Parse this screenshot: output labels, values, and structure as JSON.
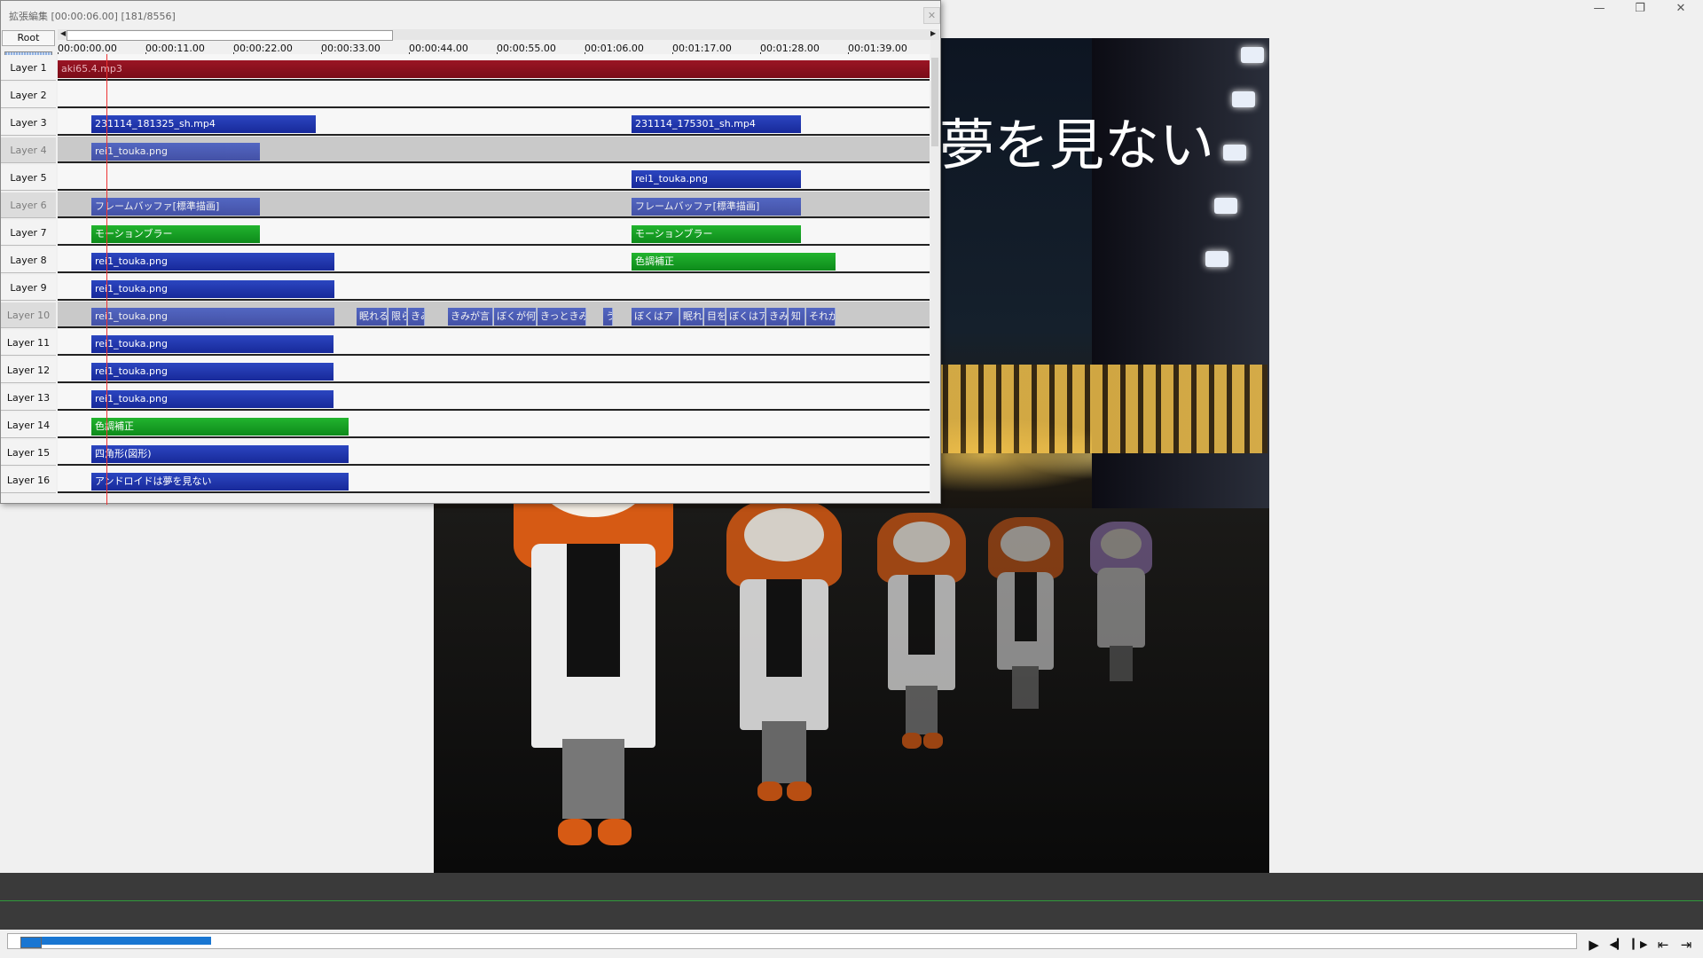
{
  "window": {
    "minimize": "—",
    "maximize": "❐",
    "close": "✕"
  },
  "timeline": {
    "title": "拡張編集 [00:00:06.00] [181/8556]",
    "close_label": "✕",
    "root_label": "Root",
    "ruler_labels": [
      "00:00:00.00",
      "00:00:11.00",
      "00:00:22.00",
      "00:00:33.00",
      "00:00:44.00",
      "00:00:55.00",
      "00:01:06.00",
      "00:01:17.00",
      "00:01:28.00",
      "00:01:39.00"
    ],
    "layers": [
      {
        "label": "Layer 1",
        "enabled": true,
        "clips": [
          {
            "name": "aki65.4.mp3",
            "kind": "audio"
          }
        ]
      },
      {
        "label": "Layer 2",
        "enabled": true,
        "clips": []
      },
      {
        "label": "Layer 3",
        "enabled": true,
        "clips": [
          {
            "name": "231114_181325_sh.mp4",
            "kind": "media"
          },
          {
            "name": "231114_175301_sh.mp4",
            "kind": "media"
          }
        ]
      },
      {
        "label": "Layer 4",
        "enabled": false,
        "clips": [
          {
            "name": "rei1_touka.png",
            "kind": "media"
          }
        ]
      },
      {
        "label": "Layer 5",
        "enabled": true,
        "clips": [
          {
            "name": "rei1_touka.png",
            "kind": "media"
          }
        ]
      },
      {
        "label": "Layer 6",
        "enabled": false,
        "clips": [
          {
            "name": "フレームバッファ[標準描画]",
            "kind": "media"
          },
          {
            "name": "フレームバッファ[標準描画]",
            "kind": "media"
          }
        ]
      },
      {
        "label": "Layer 7",
        "enabled": true,
        "clips": [
          {
            "name": "モーションブラー",
            "kind": "filter"
          },
          {
            "name": "モーションブラー",
            "kind": "filter"
          }
        ]
      },
      {
        "label": "Layer 8",
        "enabled": true,
        "clips": [
          {
            "name": "rei1_touka.png",
            "kind": "media"
          },
          {
            "name": "色調補正",
            "kind": "filter"
          }
        ]
      },
      {
        "label": "Layer 9",
        "enabled": true,
        "clips": [
          {
            "name": "rei1_touka.png",
            "kind": "media"
          }
        ]
      },
      {
        "label": "Layer 10",
        "enabled": false,
        "clips": [
          {
            "name": "rei1_touka.png",
            "kind": "media"
          },
          {
            "name": "眠れると",
            "kind": "media"
          },
          {
            "name": "限ら",
            "kind": "media"
          },
          {
            "name": "きみ",
            "kind": "media"
          },
          {
            "name": "きみが言",
            "kind": "media"
          },
          {
            "name": "ぼくが何",
            "kind": "media"
          },
          {
            "name": "きっときみ",
            "kind": "media"
          },
          {
            "name": "う",
            "kind": "media"
          },
          {
            "name": "ぼくはア",
            "kind": "media"
          },
          {
            "name": "眠れ",
            "kind": "media"
          },
          {
            "name": "目を",
            "kind": "media"
          },
          {
            "name": "ぼくはア",
            "kind": "media"
          },
          {
            "name": "きみ",
            "kind": "media"
          },
          {
            "name": "知",
            "kind": "media"
          },
          {
            "name": "それが",
            "kind": "media"
          }
        ]
      },
      {
        "label": "Layer 11",
        "enabled": true,
        "clips": [
          {
            "name": "rei1_touka.png",
            "kind": "media"
          }
        ]
      },
      {
        "label": "Layer 12",
        "enabled": true,
        "clips": [
          {
            "name": "rei1_touka.png",
            "kind": "media"
          }
        ]
      },
      {
        "label": "Layer 13",
        "enabled": true,
        "clips": [
          {
            "name": "rei1_touka.png",
            "kind": "media"
          }
        ]
      },
      {
        "label": "Layer 14",
        "enabled": true,
        "clips": [
          {
            "name": "色調補正",
            "kind": "filter"
          }
        ]
      },
      {
        "label": "Layer 15",
        "enabled": true,
        "clips": [
          {
            "name": "四角形(図形)",
            "kind": "media"
          }
        ]
      },
      {
        "label": "Layer 16",
        "enabled": true,
        "clips": [
          {
            "name": "アンドロイドは夢を見ない",
            "kind": "media"
          }
        ]
      }
    ]
  },
  "preview": {
    "caption": "夢を見ない"
  },
  "transport": {
    "play": "▶",
    "prev_frame": "◀▎",
    "next_frame": "▎▶",
    "to_start": "⇤",
    "to_end": "⇥"
  }
}
